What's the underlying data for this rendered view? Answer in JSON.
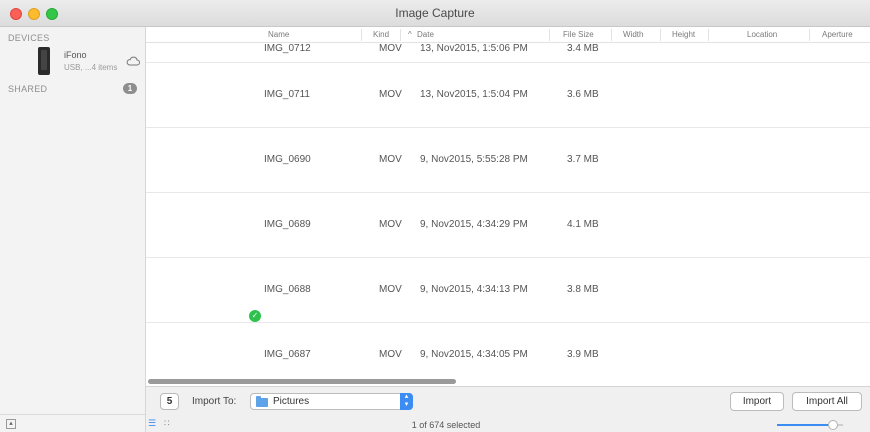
{
  "window": {
    "title": "Image Capture"
  },
  "sidebar": {
    "devices_heading": "DEVICES",
    "device": {
      "name": "iFono",
      "subtitle": "USB, ...4 items"
    },
    "shared_heading": "SHARED",
    "shared_count": "1"
  },
  "columns": {
    "name": "Name",
    "kind": "Kind",
    "date": "Date",
    "date_sort_indicator": "^",
    "file_size": "File Size",
    "width": "Width",
    "height": "Height",
    "location": "Location",
    "aperture": "Aperture"
  },
  "rows": [
    {
      "name": "IMG_0712",
      "kind": "MOV",
      "date": "13, Nov2015, 1:5:06 PM",
      "size": "3.4 MB"
    },
    {
      "name": "IMG_0711",
      "kind": "MOV",
      "date": "13, Nov2015, 1:5:04 PM",
      "size": "3.6 MB"
    },
    {
      "name": "IMG_0690",
      "kind": "MOV",
      "date": "9, Nov2015, 5:55:28 PM",
      "size": "3.7 MB"
    },
    {
      "name": "IMG_0689",
      "kind": "MOV",
      "date": "9, Nov2015, 4:34:29 PM",
      "size": "4.1 MB"
    },
    {
      "name": "IMG_0688",
      "kind": "MOV",
      "date": "9, Nov2015, 4:34:13 PM",
      "size": "3.8 MB",
      "imported": true
    },
    {
      "name": "IMG_0687",
      "kind": "MOV",
      "date": "9, Nov2015, 4:34:05 PM",
      "size": "3.9 MB"
    }
  ],
  "toolbar": {
    "rotate_icon": "rotate-left-icon",
    "rotate_glyph": "5",
    "import_to_label": "Import To:",
    "folder_name": "Pictures",
    "import_label": "Import",
    "import_all_label": "Import All"
  },
  "status": {
    "selection_text": "1 of 674 selected",
    "zoom_level": 0.85
  },
  "colors": {
    "accent": "#3b8cf3",
    "check_green": "#2ec24d",
    "folder_blue": "#5ea2e8"
  }
}
